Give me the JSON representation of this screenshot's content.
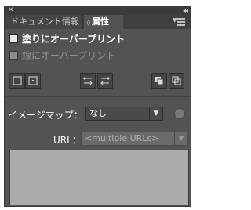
{
  "titlebar": {
    "close_glyph": "✕",
    "collapse_glyph": "◂◂"
  },
  "tabs": [
    {
      "label": "ドキュメント情報"
    },
    {
      "label": "属性",
      "arrows": "◊"
    }
  ],
  "checkboxes": {
    "overprint_fill": {
      "label": "塗りにオーバープリント",
      "enabled": true
    },
    "overprint_stroke": {
      "label": "線にオーバープリント",
      "enabled": false
    }
  },
  "icons": [
    "show-center-icon",
    "hide-center-icon",
    "reverse-path-direction-off-icon",
    "reverse-path-direction-on-icon",
    "nonzero-winding-fill-rule-icon",
    "even-odd-fill-rule-icon"
  ],
  "image_map": {
    "label": "イメージマップ：",
    "value": "なし",
    "arrow": "▼"
  },
  "url": {
    "label": "URL：",
    "value": "<multiple URLs>",
    "arrow": "▼"
  },
  "colors": {
    "panel_bg": "#535353",
    "text": "#ffffff",
    "url_bg": "#ababab"
  }
}
